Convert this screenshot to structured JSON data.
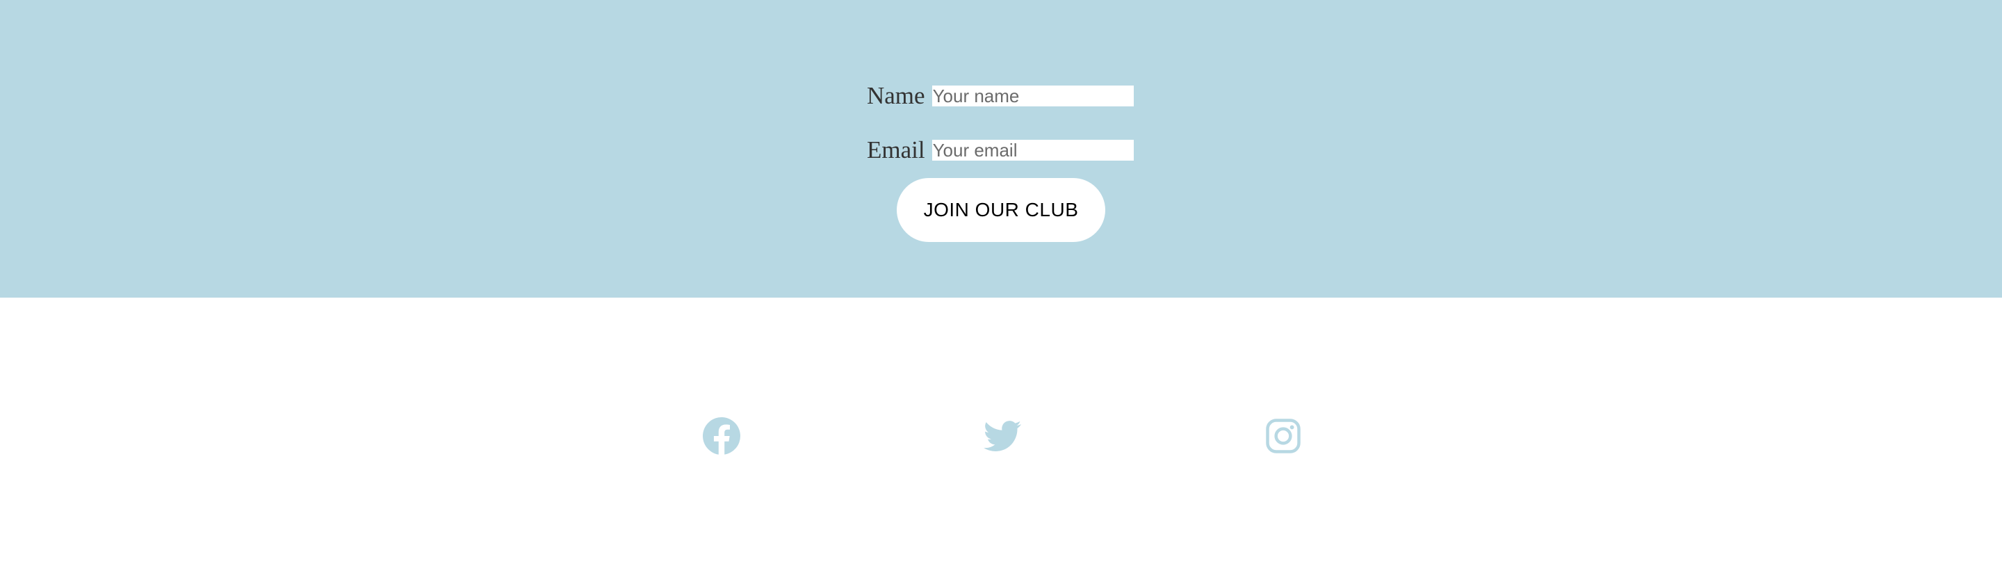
{
  "signup": {
    "name_label": "Name",
    "name_placeholder": "Your name",
    "email_label": "Email",
    "email_placeholder": "Your email",
    "join_button_label": "JOIN OUR CLUB"
  },
  "social": {
    "icons": [
      "facebook-icon",
      "twitter-icon",
      "instagram-icon"
    ],
    "icon_color": "#b7d8e3"
  },
  "colors": {
    "signup_background": "#b7d8e3",
    "page_background": "#ffffff"
  }
}
